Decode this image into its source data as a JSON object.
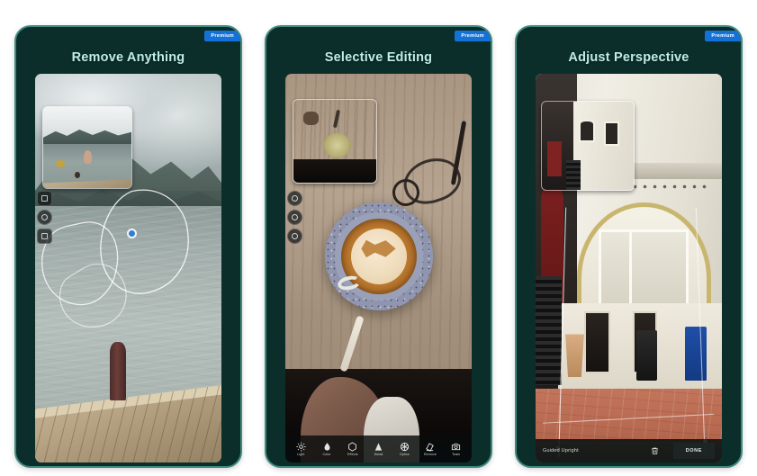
{
  "page": {
    "background_color": "#ffffff",
    "card_background": "#0b2e2b",
    "card_border_color": "#3f8a7f",
    "title_color": "#bfeee4",
    "badge_color": "#1272d8"
  },
  "panels": [
    {
      "title": "Remove Anything",
      "badge": "Premium",
      "subject": "lake-pier-photo",
      "thumbnail_label": "before-thumbnail",
      "overlay": {
        "cursor_label": "brush-cursor",
        "selection_label": "brush-selection-outline"
      },
      "tools": [
        {
          "name": "brush-tool",
          "icon": "square-icon"
        },
        {
          "name": "lasso-tool",
          "icon": "circle-icon"
        },
        {
          "name": "eraser-tool",
          "icon": "square-icon"
        }
      ]
    },
    {
      "title": "Selective Editing",
      "badge": "Premium",
      "subject": "latte-coffee-photo",
      "thumbnail_label": "before-thumbnail",
      "tools": [
        {
          "name": "control-point-1",
          "icon": "circle-icon"
        },
        {
          "name": "control-point-2",
          "icon": "circle-icon"
        },
        {
          "name": "control-point-3",
          "icon": "circle-icon"
        }
      ],
      "toolbar": [
        {
          "label": "Light",
          "icon": "sun-icon"
        },
        {
          "label": "Color",
          "icon": "droplet-icon"
        },
        {
          "label": "Effects",
          "icon": "hexagon-icon"
        },
        {
          "label": "Detail",
          "icon": "triangle-icon"
        },
        {
          "label": "Optics",
          "icon": "aperture-icon"
        },
        {
          "label": "Remove",
          "icon": "eraser-icon"
        },
        {
          "label": "Team",
          "icon": "camera-icon"
        }
      ]
    },
    {
      "title": "Adjust Perspective",
      "badge": "Premium",
      "subject": "amsterdam-building-photo",
      "thumbnail_label": "before-thumbnail",
      "bottom_bar": {
        "mode_label": "Guided Upright",
        "trash_icon": "trash-icon",
        "done_label": "DONE"
      }
    }
  ]
}
